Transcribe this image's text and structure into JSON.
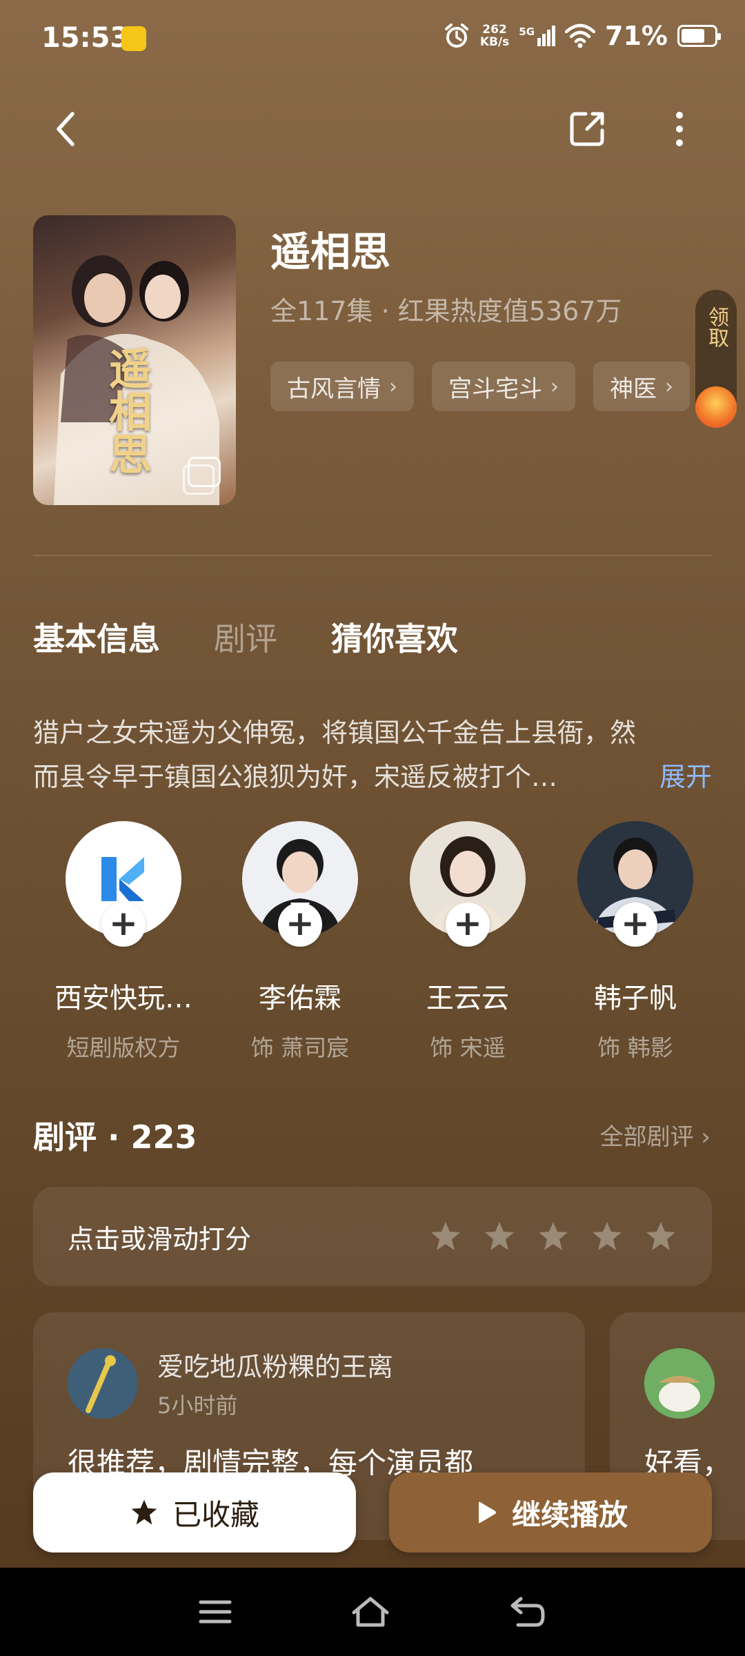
{
  "status_bar": {
    "time": "15:53",
    "net_speed_value": "262",
    "net_speed_unit": "KB/s",
    "network_type": "5G",
    "battery_percent": "71%",
    "battery_level": 0.71
  },
  "drama": {
    "title": "遥相思",
    "poster_title": "遥相思",
    "meta": "全117集 · 红果热度值5367万",
    "tags": [
      "古风言情",
      "宫斗宅斗",
      "神医"
    ]
  },
  "reward": {
    "label": "领取"
  },
  "tabs": [
    "基本信息",
    "剧评",
    "猜你喜欢"
  ],
  "synopsis": {
    "line1": "猎户之女宋遥为父伸冤，将镇国公千金告上县衙，然",
    "line2": "而县令早于镇国公狼狈为奸，宋遥反被打个…",
    "expand": "展开"
  },
  "cast": [
    {
      "name": "西安快玩…",
      "role": "短剧版权方"
    },
    {
      "name": "李佑霖",
      "role": "饰 萧司宸"
    },
    {
      "name": "王云云",
      "role": "饰 宋遥"
    },
    {
      "name": "韩子帆",
      "role": "饰 韩影"
    }
  ],
  "reviews": {
    "title": "剧评 · 223",
    "all_label": "全部剧评",
    "rate_prompt": "点击或滑动打分",
    "items": [
      {
        "user": "爱吃地瓜粉粿的王离",
        "time": "5小时前",
        "text": "很推荐，剧情完整，每个演员都"
      },
      {
        "text": "好看，"
      }
    ]
  },
  "actions": {
    "favorite_label": "已收藏",
    "play_label": "继续播放"
  },
  "colors": {
    "accent_play": "#8e6236",
    "expand_link": "#8fb8ff",
    "reward_text": "#f2cf88"
  }
}
